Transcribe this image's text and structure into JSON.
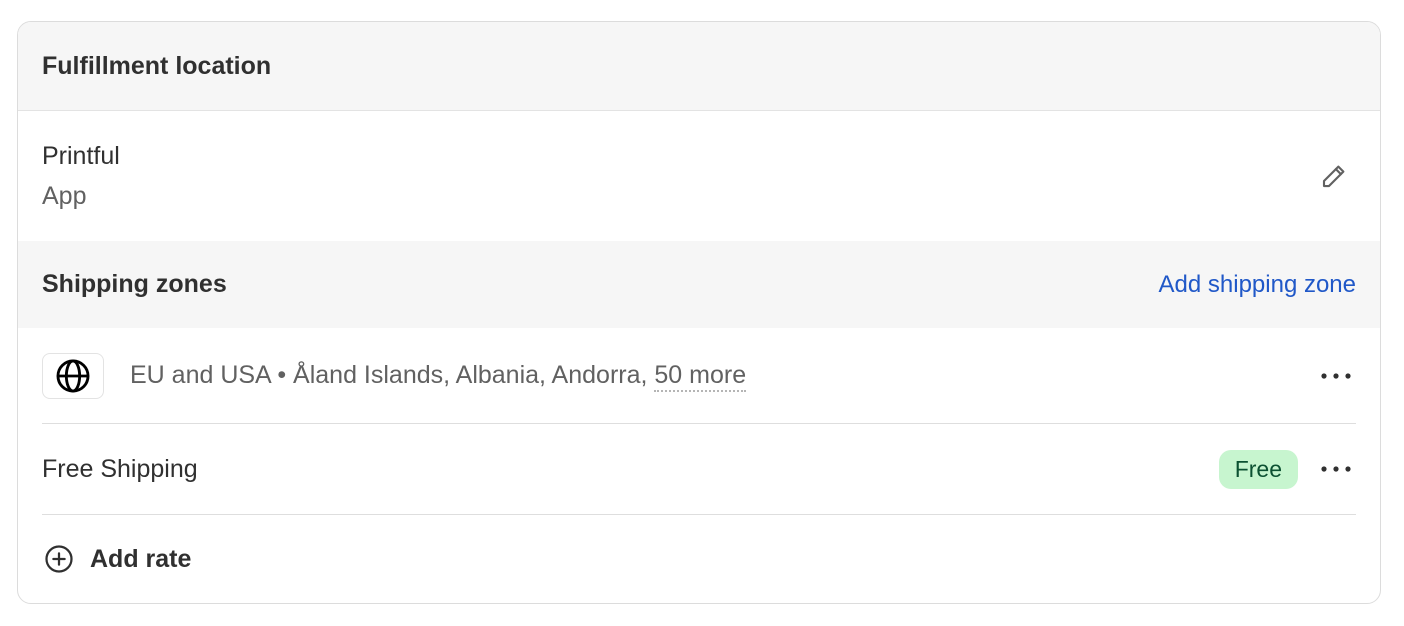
{
  "fulfillment": {
    "header_title": "Fulfillment location",
    "location_name": "Printful",
    "location_type": "App",
    "edit_icon": "pencil-icon"
  },
  "shipping_zones": {
    "header_title": "Shipping zones",
    "add_zone_label": "Add shipping zone",
    "zone": {
      "icon": "globe-icon",
      "name": "EU and USA",
      "separator": "•",
      "countries": "Åland Islands, Albania, Andorra,",
      "more_label": "50 more",
      "menu_icon": "more-horizontal-icon"
    },
    "rates": [
      {
        "name": "Free Shipping",
        "badge": "Free",
        "menu_icon": "more-horizontal-icon"
      }
    ],
    "add_rate_label": "Add rate",
    "add_rate_icon": "plus-circle-icon"
  },
  "colors": {
    "link": "#2058c8",
    "badge_bg": "#c7f5cf",
    "badge_text": "#0c5132",
    "header_bg": "#f6f6f6"
  }
}
